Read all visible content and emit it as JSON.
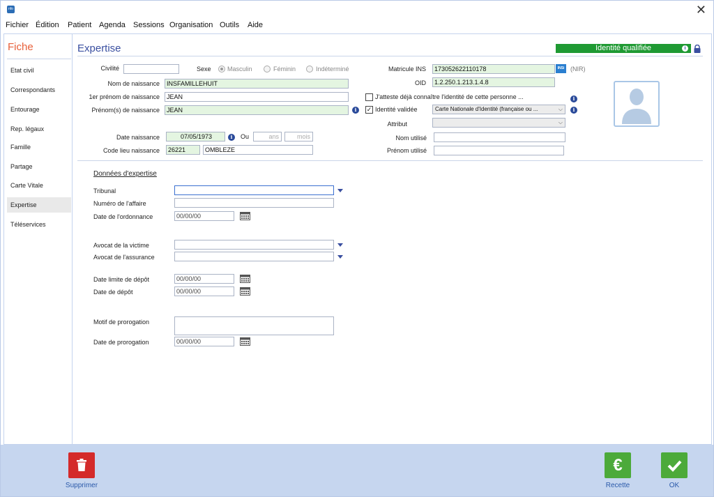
{
  "menu": [
    "Fichier",
    "Édition",
    "Patient",
    "Agenda",
    "Sessions",
    "Organisation",
    "Outils",
    "Aide"
  ],
  "app_icon_text": "nfo",
  "sidebar": {
    "title": "Fiche",
    "items": [
      "Etat civil",
      "Correspondants",
      "Entourage",
      "Rep. légaux",
      "Famille",
      "Partage",
      "Carte Vitale",
      "Expertise",
      "Téléservices"
    ]
  },
  "header": {
    "title": "Expertise",
    "identity_badge": "Identité qualifiée"
  },
  "identity": {
    "civilite_label": "Civilité",
    "sexe_label": "Sexe",
    "sexe_options": [
      "Masculin",
      "Féminin",
      "Indéterminé"
    ],
    "nom_naissance_label": "Nom de naissance",
    "nom_naissance": "INSFAMILLEHUIT",
    "premier_prenom_label": "1er prénom de naissance",
    "premier_prenom": "JEAN",
    "prenoms_label": "Prénom(s) de naissance",
    "prenoms": "JEAN",
    "date_naissance_label": "Date naissance",
    "date_naissance": "07/05/1973",
    "ou_label": "Ou",
    "ans_placeholder": "ans",
    "mois_placeholder": "mois",
    "code_lieu_label": "Code lieu naissance",
    "code_lieu": "26221",
    "lieu": "OMBLEZE",
    "matricule_label": "Matricule INS",
    "matricule": "173052622110178",
    "nir": "(NIR)",
    "ins_logo": "INSi",
    "oid_label": "OID",
    "oid": "1.2.250.1.213.1.4.8",
    "atteste_label": "J'atteste déjà connaître l'identité de cette personne ...",
    "identite_validee_label": "Identité validée",
    "piece_identite": "Carte Nationale d'Identité (française ou ...",
    "attribut_label": "Attribut",
    "nom_utilise_label": "Nom utilisé",
    "prenom_utilise_label": "Prénom utilisé"
  },
  "expertise": {
    "section_title": "Données d'expertise",
    "tribunal_label": "Tribunal",
    "numero_affaire_label": "Numéro de l'affaire",
    "date_ordonnance_label": "Date de l'ordonnance",
    "date_ordonnance": "00/00/00",
    "avocat_victime_label": "Avocat de la victime",
    "avocat_assurance_label": "Avocat de l'assurance",
    "date_limite_label": "Date limite de dépôt",
    "date_limite": "00/00/00",
    "date_depot_label": "Date de dépôt",
    "date_depot": "00/00/00",
    "motif_label": "Motif de prorogation",
    "date_prorogation_label": "Date de prorogation",
    "date_prorogation": "00/00/00"
  },
  "actions": {
    "supprimer": "Supprimer",
    "recette": "Recette",
    "recette_symbol": "€",
    "ok": "OK"
  },
  "colors": {
    "accent": "#3a4fa0",
    "fiche": "#e8603a",
    "qualified": "#1f9a33",
    "delete": "#d42a2a",
    "confirm": "#4caa3a",
    "bottom_bar": "#c6d6ef"
  }
}
